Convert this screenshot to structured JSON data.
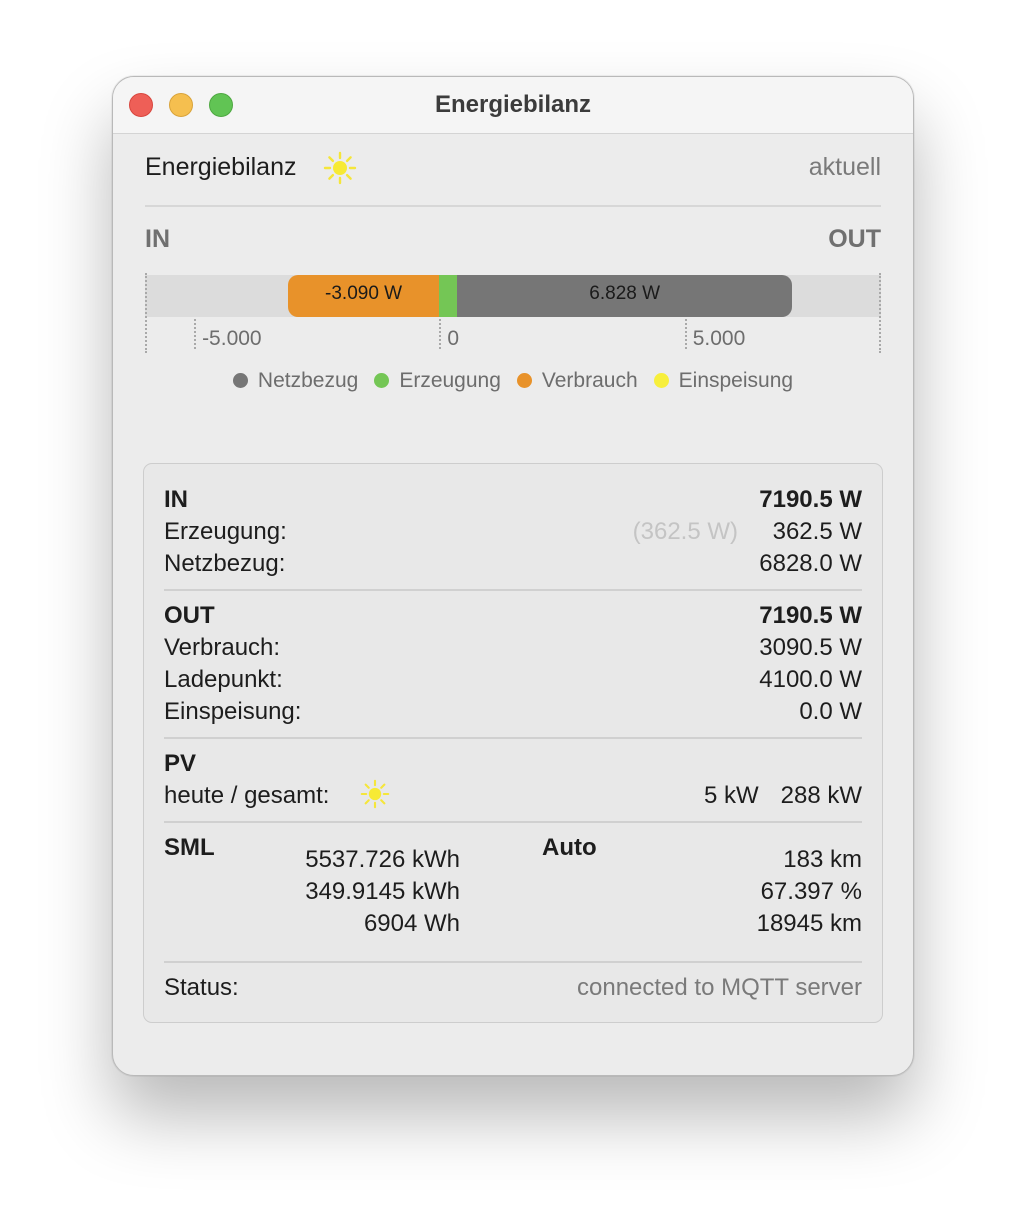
{
  "window": {
    "title": "Energiebilanz"
  },
  "header": {
    "title": "Energiebilanz",
    "sun_icon": "sun-icon",
    "mode": "aktuell"
  },
  "chart_data": {
    "type": "bar",
    "orientation": "horizontal-stacked",
    "in_label": "IN",
    "out_label": "OUT",
    "xlim": [
      -6000,
      9000
    ],
    "ticks": [
      {
        "value": -5000,
        "label": "-5.000"
      },
      {
        "value": 0,
        "label": "0"
      },
      {
        "value": 5000,
        "label": "5.000"
      }
    ],
    "segments": [
      {
        "name": "Verbrauch",
        "start": -3090,
        "end": 0,
        "label": "-3.090 W",
        "color": "#e8922a"
      },
      {
        "name": "Erzeugung",
        "start": 0,
        "end": 362.5,
        "label": "",
        "color": "#74c655"
      },
      {
        "name": "Netzbezug",
        "start": 362.5,
        "end": 7190.5,
        "label": "6.828 W",
        "color": "#767676"
      }
    ],
    "legend": [
      {
        "name": "Netzbezug",
        "color": "#767676"
      },
      {
        "name": "Erzeugung",
        "color": "#74c655"
      },
      {
        "name": "Verbrauch",
        "color": "#e8922a"
      },
      {
        "name": "Einspeisung",
        "color": "#f7ef3c"
      }
    ]
  },
  "summary": {
    "in": {
      "title": "IN",
      "total": "7190.5 W",
      "erzeugung_label": "Erzeugung:",
      "erzeugung_faint": "(362.5 W)",
      "erzeugung_value": "362.5 W",
      "netzbezug_label": "Netzbezug:",
      "netzbezug_value": "6828.0 W"
    },
    "out": {
      "title": "OUT",
      "total": "7190.5 W",
      "verbrauch_label": "Verbrauch:",
      "verbrauch_value": "3090.5 W",
      "ladepunkt_label": "Ladepunkt:",
      "ladepunkt_value": "4100.0 W",
      "einspeisung_label": "Einspeisung:",
      "einspeisung_value": "0.0 W"
    },
    "pv": {
      "title": "PV",
      "label": "heute / gesamt:",
      "today": "5 kW",
      "total": "288 kW"
    },
    "sml": {
      "title": "SML",
      "values": [
        "5537.726 kWh",
        "349.9145 kWh",
        "6904 Wh"
      ]
    },
    "auto": {
      "title": "Auto",
      "values": [
        "183 km",
        "67.397 %",
        "18945 km"
      ]
    },
    "status": {
      "label": "Status:",
      "value": "connected to MQTT server"
    }
  }
}
